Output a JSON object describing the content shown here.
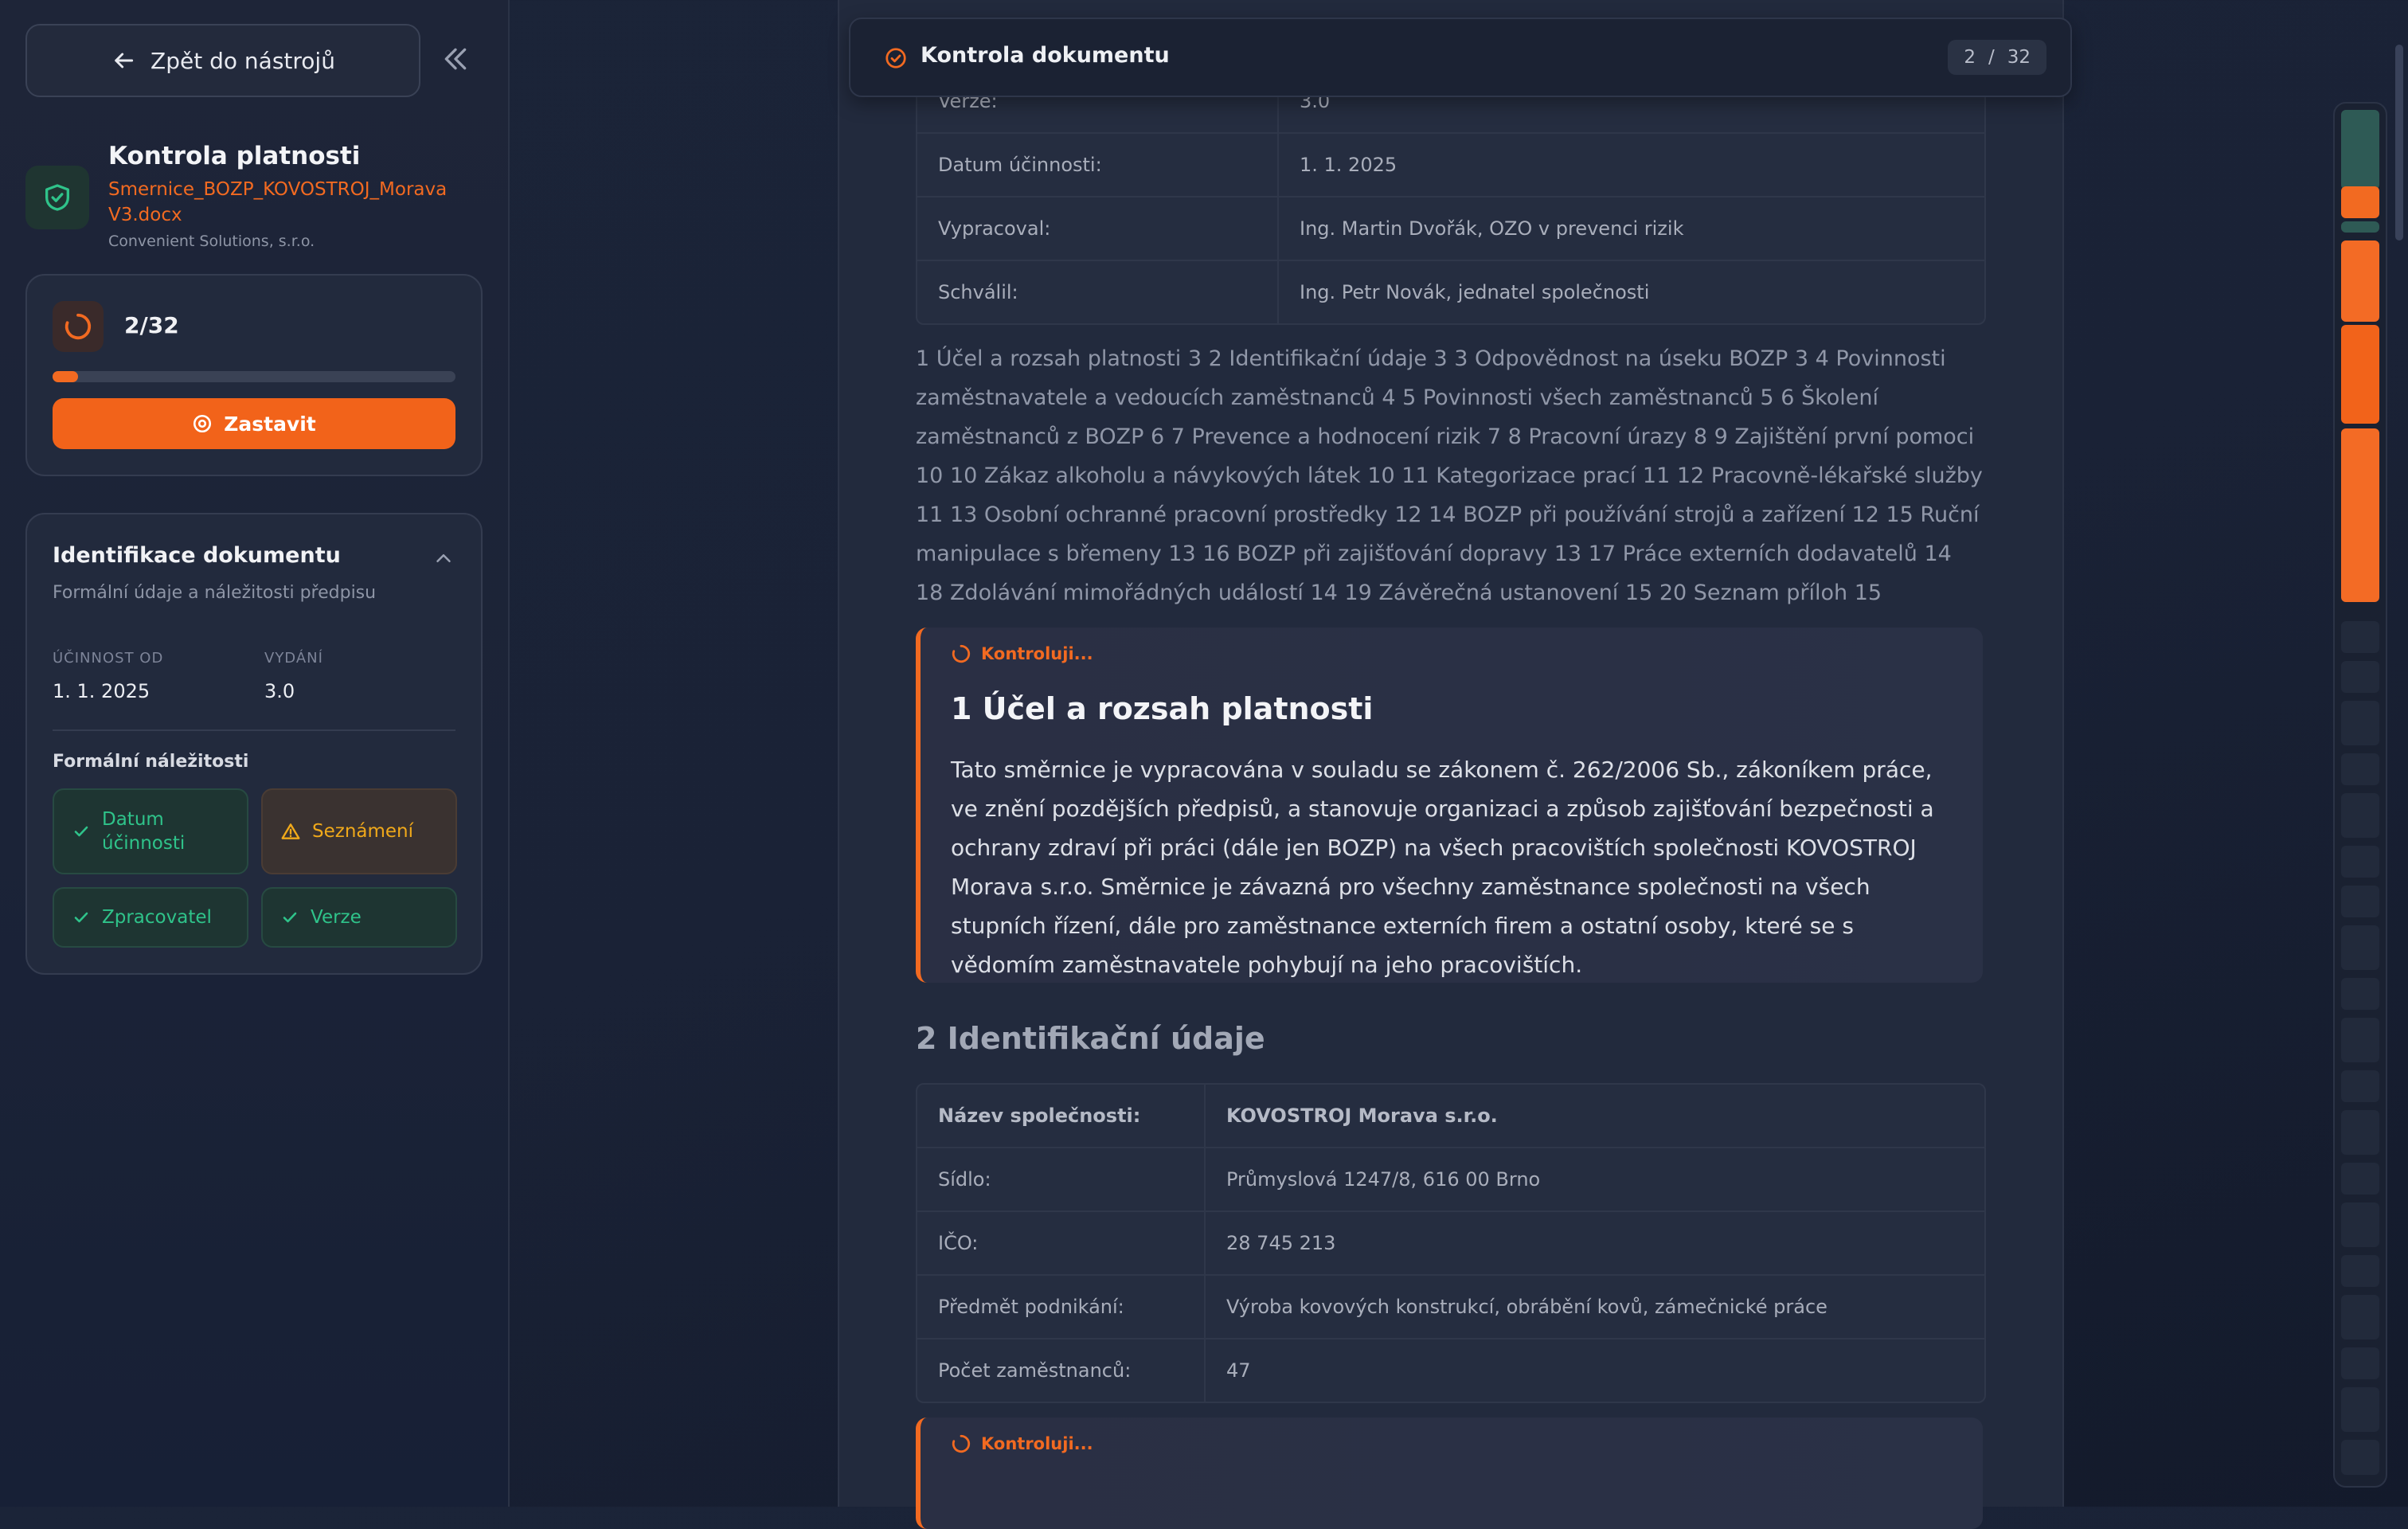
{
  "sidebar": {
    "back_label": "Zpět do nástrojů",
    "doc_title": "Kontrola platnosti",
    "doc_file": "Smernice_BOZP_KOVOSTROJ_Morava V3.docx",
    "company": "Convenient Solutions, s.r.o.",
    "progress": {
      "count": "2/32",
      "fraction": 0.0625,
      "stop_label": "Zastavit"
    },
    "identification": {
      "title": "Identifikace dokumentu",
      "subtitle": "Formální údaje a náležitosti předpisu",
      "effective_label": "ÚČINNOST OD",
      "effective_value": "1. 1. 2025",
      "edition_label": "VYDÁNÍ",
      "edition_value": "3.0",
      "formal_title": "Formální náležitosti",
      "chips": [
        {
          "label": "Datum účinnosti",
          "status": "ok"
        },
        {
          "label": "Seznámení",
          "status": "warning"
        },
        {
          "label": "Zpracovatel",
          "status": "ok"
        },
        {
          "label": "Verze",
          "status": "ok"
        }
      ]
    }
  },
  "topbar": {
    "title": "Kontrola dokumentu",
    "current": "2",
    "separator": "/",
    "total": "32"
  },
  "header_table": [
    {
      "key": "Verze:",
      "value": "3.0"
    },
    {
      "key": "Datum účinnosti:",
      "value": "1. 1. 2025"
    },
    {
      "key": "Vypracoval:",
      "value": "Ing. Martin Dvořák, OZO v prevenci rizik"
    },
    {
      "key": "Schválil:",
      "value": "Ing. Petr Novák, jednatel společnosti"
    }
  ],
  "toc": "1 Účel a rozsah platnosti 3 2 Identifikační údaje 3 3 Odpovědnost na úseku BOZP 3 4 Povinnosti zaměstnavatele a vedoucích zaměstnanců 4 5 Povinnosti všech zaměstnanců 5 6 Školení zaměstnanců z BOZP 6 7 Prevence a hodnocení rizik 7 8 Pracovní úrazy 8 9 Zajištění první pomoci 10 10 Zákaz alkoholu a návykových látek 10 11 Kategorizace prací 11 12 Pracovně-lékařské služby 11 13 Osobní ochranné pracovní prostředky 12 14 BOZP při používání strojů a zařízení 12 15 Ruční manipulace s břemeny 13 16 BOZP při zajišťování dopravy 13 17 Práce externích dodavatelů 14 18 Zdolávání mimořádných událostí 14 19 Závěrečná ustanovení 15 20 Seznam příloh 15",
  "section1": {
    "status": "Kontroluji...",
    "title": "1 Účel a rozsah platnosti",
    "body": "Tato směrnice je vypracována v souladu se zákonem č. 262/2006 Sb., zákoníkem práce, ve znění pozdějších předpisů, a stanovuje organizaci a způsob zajišťování bezpečnosti a ochrany zdraví při práci (dále jen BOZP) na všech pracovištích společnosti KOVOSTROJ Morava s.r.o. Směrnice je závazná pro všechny zaměstnance společnosti na všech stupních řízení, dále pro zaměstnance externích firem a ostatní osoby, které se s vědomím zaměstnavatele pohybují na jeho pracovištích."
  },
  "section2": {
    "title": "2 Identifikační údaje",
    "table": [
      {
        "key": "Název společnosti:",
        "value": "KOVOSTROJ Morava s.r.o."
      },
      {
        "key": "Sídlo:",
        "value": "Průmyslová 1247/8, 616 00 Brno"
      },
      {
        "key": "IČO:",
        "value": "28 745 213"
      },
      {
        "key": "Předmět podnikání:",
        "value": "Výroba kovových konstrukcí, obrábění kovů, zámečnické práce"
      },
      {
        "key": "Počet zaměstnanců:",
        "value": "47"
      }
    ]
  },
  "section3": {
    "status": "Kontroluji..."
  },
  "colors": {
    "accent": "#f26a21",
    "ok": "#2fc38a",
    "warning": "#f0a91a",
    "bg": "#1b2438"
  }
}
